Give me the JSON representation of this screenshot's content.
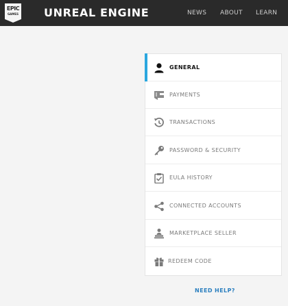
{
  "header": {
    "logo_line1": "EPIC",
    "logo_line2": "GAMES",
    "title": "UNREAL ENGINE",
    "nav": {
      "news": "NEWS",
      "about": "ABOUT",
      "learn": "LEARN"
    }
  },
  "menu": {
    "items": [
      {
        "label": "GENERAL",
        "icon": "user-icon",
        "active": true
      },
      {
        "label": "PAYMENTS",
        "icon": "wallet-icon",
        "active": false
      },
      {
        "label": "TRANSACTIONS",
        "icon": "history-icon",
        "active": false
      },
      {
        "label": "PASSWORD & SECURITY",
        "icon": "key-icon",
        "active": false
      },
      {
        "label": "EULA HISTORY",
        "icon": "clipboard-check-icon",
        "active": false
      },
      {
        "label": "CONNECTED ACCOUNTS",
        "icon": "share-icon",
        "active": false
      },
      {
        "label": "MARKETPLACE SELLER",
        "icon": "seller-icon",
        "active": false
      },
      {
        "label": "REDEEM CODE",
        "icon": "gift-icon",
        "active": false
      }
    ]
  },
  "help": {
    "label": "NEED HELP?"
  },
  "colors": {
    "accent": "#2ba7df",
    "header_bg": "#2a2a2a",
    "link": "#2b7fbf"
  }
}
